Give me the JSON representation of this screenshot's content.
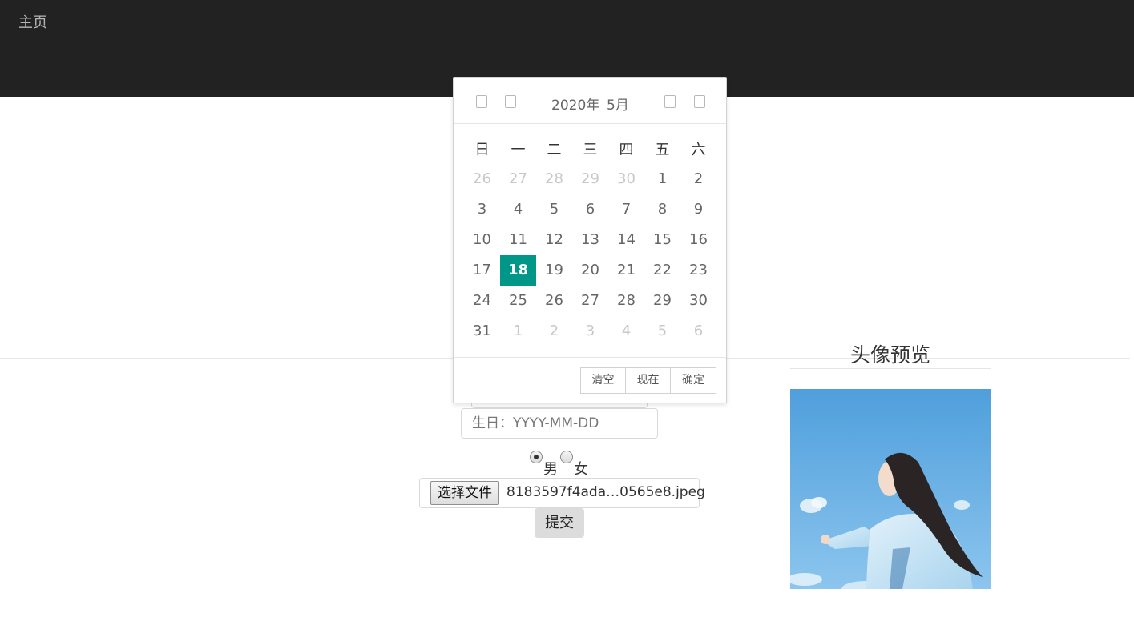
{
  "navbar": {
    "home_label": "主页"
  },
  "form": {
    "birthday_placeholder": "生日：YYYY-MM-DD",
    "gender_options": [
      {
        "label": "男",
        "checked": true
      },
      {
        "label": "女",
        "checked": false
      }
    ],
    "file_button_label": "选择文件",
    "file_name": "8183597f4ada…0565e8.jpeg",
    "submit_label": "提交"
  },
  "preview": {
    "title": "头像预览"
  },
  "datepicker": {
    "year_label": "2020年",
    "month_label": "5月",
    "weekdays": [
      "日",
      "一",
      "二",
      "三",
      "四",
      "五",
      "六"
    ],
    "days": [
      {
        "d": "26",
        "muted": true
      },
      {
        "d": "27",
        "muted": true
      },
      {
        "d": "28",
        "muted": true
      },
      {
        "d": "29",
        "muted": true
      },
      {
        "d": "30",
        "muted": true
      },
      {
        "d": "1"
      },
      {
        "d": "2"
      },
      {
        "d": "3"
      },
      {
        "d": "4"
      },
      {
        "d": "5"
      },
      {
        "d": "6"
      },
      {
        "d": "7"
      },
      {
        "d": "8"
      },
      {
        "d": "9"
      },
      {
        "d": "10"
      },
      {
        "d": "11"
      },
      {
        "d": "12"
      },
      {
        "d": "13"
      },
      {
        "d": "14"
      },
      {
        "d": "15"
      },
      {
        "d": "16"
      },
      {
        "d": "17"
      },
      {
        "d": "18",
        "selected": true
      },
      {
        "d": "19"
      },
      {
        "d": "20"
      },
      {
        "d": "21"
      },
      {
        "d": "22"
      },
      {
        "d": "23"
      },
      {
        "d": "24"
      },
      {
        "d": "25"
      },
      {
        "d": "26"
      },
      {
        "d": "27"
      },
      {
        "d": "28"
      },
      {
        "d": "29"
      },
      {
        "d": "30"
      },
      {
        "d": "31"
      },
      {
        "d": "1",
        "muted": true
      },
      {
        "d": "2",
        "muted": true
      },
      {
        "d": "3",
        "muted": true
      },
      {
        "d": "4",
        "muted": true
      },
      {
        "d": "5",
        "muted": true
      },
      {
        "d": "6",
        "muted": true
      }
    ],
    "buttons": {
      "clear": "清空",
      "now": "现在",
      "confirm": "确定"
    },
    "accent_color": "#009688"
  }
}
